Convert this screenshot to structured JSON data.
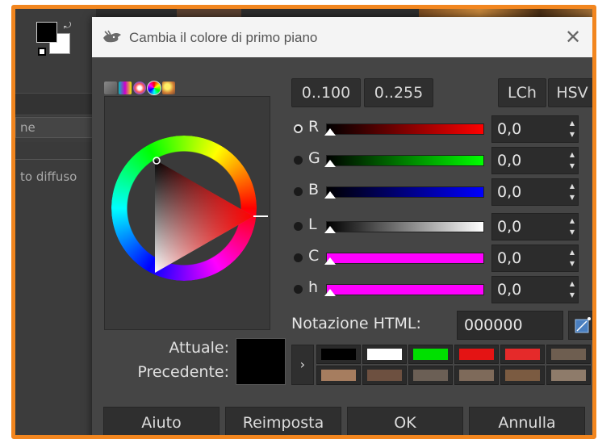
{
  "dialog": {
    "title": "Cambia il colore di primo piano",
    "close_glyph": "✕"
  },
  "background": {
    "text_top": "ne",
    "text_bottom": "to diffuso"
  },
  "selectors": {
    "icons": [
      "gimp-selector-icon",
      "cmyk-selector-icon",
      "watercolor-selector-icon",
      "wheel-selector-icon",
      "palette-selector-icon"
    ]
  },
  "swatch": {
    "current_label": "Attuale:",
    "previous_label": "Precedente:",
    "current_color": "#000000"
  },
  "ranges": {
    "range_100": "0..100",
    "range_255": "0..255"
  },
  "modes": {
    "lch": "LCh",
    "hsv": "HSV"
  },
  "channels": [
    {
      "label": "R",
      "value": "0,0",
      "gradient": "linear-gradient(90deg,#000000,#ff0000)"
    },
    {
      "label": "G",
      "value": "0,0",
      "gradient": "linear-gradient(90deg,#000000,#00ff00)"
    },
    {
      "label": "B",
      "value": "0,0",
      "gradient": "linear-gradient(90deg,#000000,#0000ff)"
    },
    {
      "label": "L",
      "value": "0,0",
      "gradient": "linear-gradient(90deg,#000000,#ffffff)"
    },
    {
      "label": "C",
      "value": "0,0",
      "gradient": "linear-gradient(90deg,#ff00ff,#ff00ff)"
    },
    {
      "label": "h",
      "value": "0,0",
      "gradient": "linear-gradient(90deg,#ff00ff,#ff00ff)"
    }
  ],
  "html": {
    "label": "Notazione HTML:",
    "value": "000000"
  },
  "history": {
    "arrow": "›",
    "colors": [
      "#000000",
      "#ffffff",
      "#00e000",
      "#e41414",
      "#e52a2a",
      "#6e5e50",
      "#a67d5f",
      "#6d5040",
      "#6b5f55",
      "#7e6a5a",
      "#7b5b41",
      "#8e7b6a"
    ]
  },
  "buttons": {
    "help": "Aiuto",
    "reset": "Reimposta",
    "ok": "OK",
    "cancel": "Annulla"
  }
}
